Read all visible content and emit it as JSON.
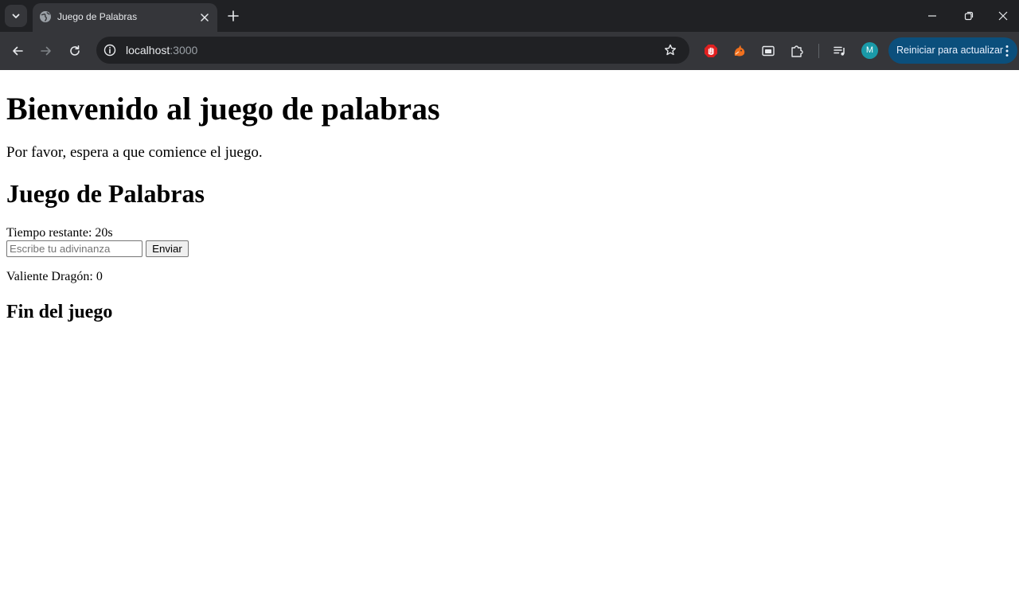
{
  "browser": {
    "tab_title": "Juego de Palabras",
    "url_host": "localhost",
    "url_port": ":3000",
    "profile_initial": "M",
    "update_label": "Reiniciar para actualizar",
    "colors": {
      "tabstrip_bg": "#202124",
      "toolbar_bg": "#35363a",
      "update_button_bg": "#0b4f7c",
      "avatar_bg": "#1a9aa8",
      "ext_adblock": "#e02020",
      "ext_orange": "#f0701e"
    },
    "icons": {
      "tab_search": "chevron-down-icon",
      "favicon": "globe-icon",
      "tab_close": "close-icon",
      "new_tab": "plus-icon",
      "back": "arrow-left-icon",
      "forward": "arrow-right-icon",
      "reload": "reload-icon",
      "site_info": "site-info-icon",
      "bookmark": "star-icon",
      "extensions": [
        "stop-hand-icon",
        "fox-icon",
        "wallet-icon",
        "puzzle-icon"
      ],
      "media": "media-queue-icon",
      "menu": "kebab-menu-icon"
    }
  },
  "page": {
    "welcome_heading": "Bienvenido al juego de palabras",
    "waiting_text": "Por favor, espera a que comience el juego.",
    "game_heading": "Juego de Palabras",
    "timer_text": "Tiempo restante: 20s",
    "guess_input": {
      "value": "",
      "placeholder": "Escribe tu adivinanza"
    },
    "send_label": "Enviar",
    "score_text": "Valiente Dragón: 0",
    "end_heading": "Fin del juego"
  }
}
